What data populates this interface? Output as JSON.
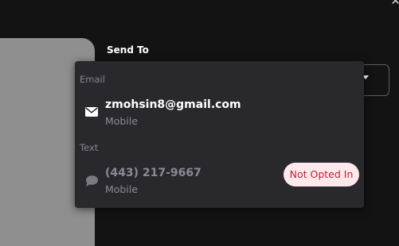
{
  "form": {
    "send_to_label": "Send To"
  },
  "window": {
    "close_glyph": "✕"
  },
  "dropdown": {
    "sections": [
      {
        "label": "Email",
        "options": [
          {
            "icon": "envelope-icon",
            "value": "zmohsin8@gmail.com",
            "sublabel": "Mobile",
            "enabled": true
          }
        ]
      },
      {
        "label": "Text",
        "options": [
          {
            "icon": "chat-bubble-icon",
            "value": "(443) 217-9667",
            "sublabel": "Mobile",
            "enabled": false,
            "badge": "Not Opted In"
          }
        ]
      }
    ]
  },
  "colors": {
    "background": "#131314",
    "dropdown_bg": "#28282d",
    "badge_bg": "#fde9ec",
    "badge_text": "#c21d3c"
  }
}
